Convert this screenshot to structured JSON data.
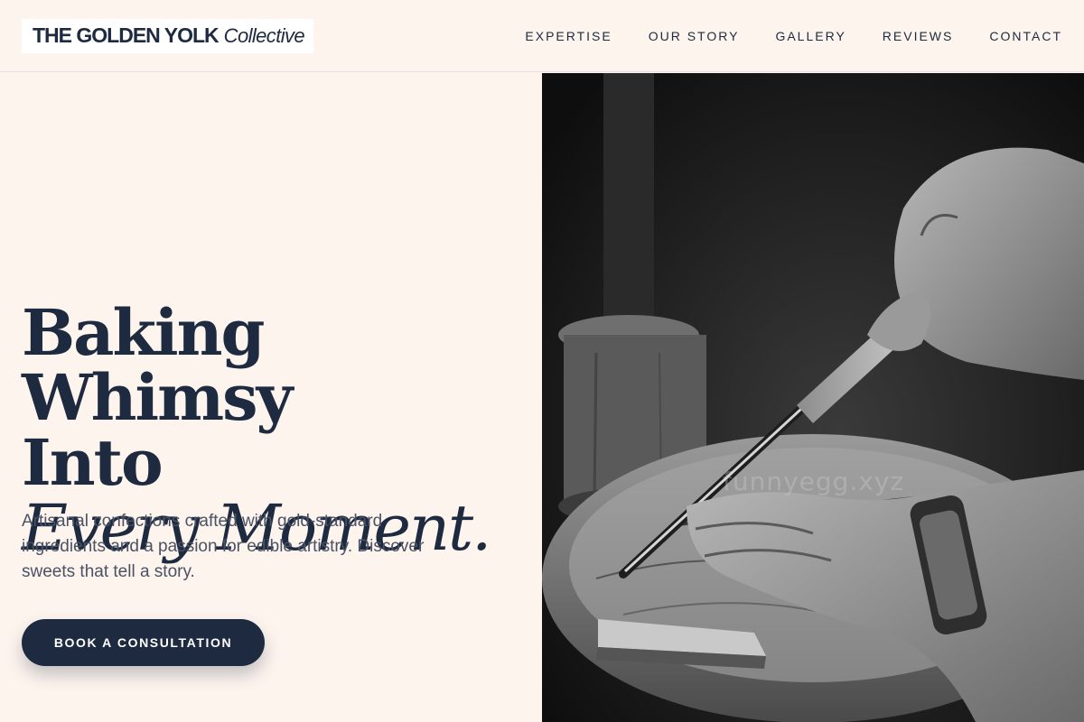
{
  "header": {
    "logo_main": "THE GOLDEN YOLK",
    "logo_sub": "Collective",
    "nav": [
      {
        "label": "EXPERTISE"
      },
      {
        "label": "OUR STORY"
      },
      {
        "label": "GALLERY"
      },
      {
        "label": "REVIEWS"
      },
      {
        "label": "CONTACT"
      }
    ]
  },
  "hero": {
    "headline_line1": "Baking Whimsy",
    "headline_line2": "Into",
    "headline_line3": "Every Moment.",
    "tagline": "Artisanal confections crafted with gold-standard ingredients and a passion for edible artistry. Discover sweets that tell a story.",
    "cta_label": "BOOK A CONSULTATION",
    "image_watermark": "funnyegg.xyz"
  },
  "colors": {
    "background": "#fdf4ee",
    "navy": "#1e2a3f",
    "body_text": "#4a5264"
  }
}
